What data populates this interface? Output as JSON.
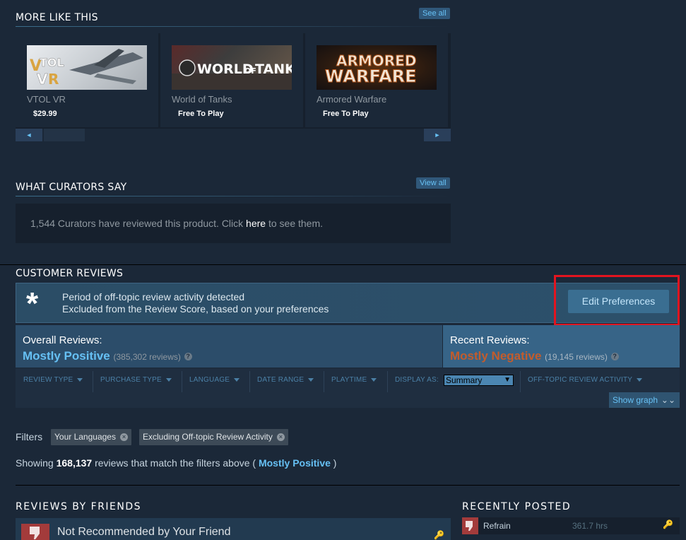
{
  "more_like_this": {
    "title": "MORE LIKE THIS",
    "see_all": "See all",
    "games": [
      {
        "name": "VTOL VR",
        "price": "$29.99",
        "capsule_text": "VTOL VR"
      },
      {
        "name": "World of Tanks",
        "price": "Free To Play",
        "capsule_text": "WORLD OF TANKS"
      },
      {
        "name": "Armored Warfare",
        "price": "Free To Play",
        "capsule_text": "ARMORED WARFARE"
      }
    ],
    "scroll_left": "◄",
    "scroll_right": "►"
  },
  "curators": {
    "title": "WHAT CURATORS SAY",
    "view_all": "View all",
    "text_before": "1,544 Curators have reviewed this product. Click ",
    "link": "here",
    "text_after": " to see them."
  },
  "customer_reviews": {
    "title": "CUSTOMER REVIEWS",
    "offtopic_line1": "Period of off-topic review activity detected",
    "offtopic_line2": "Excluded from the Review Score, based on your preferences",
    "edit_preferences": "Edit Preferences",
    "overall_label": "Overall Reviews:",
    "overall_score": "Mostly Positive",
    "overall_count": "(385,302 reviews)",
    "recent_label": "Recent Reviews:",
    "recent_score": "Mostly Negative",
    "recent_count": "(19,145 reviews)",
    "help": "?"
  },
  "filter_bar": {
    "items": [
      "REVIEW TYPE",
      "PURCHASE TYPE",
      "LANGUAGE",
      "DATE RANGE",
      "PLAYTIME"
    ],
    "display_as_label": "DISPLAY AS:",
    "display_as_value": "Summary",
    "offtopic_item": "OFF-TOPIC REVIEW ACTIVITY",
    "show_graph": "Show graph"
  },
  "filters": {
    "label": "Filters",
    "chips": [
      "Your Languages",
      "Excluding Off-topic Review Activity"
    ],
    "showing_before": "Showing ",
    "showing_count": "168,137",
    "showing_mid": " reviews that match the filters above ( ",
    "showing_score": "Mostly Positive",
    "showing_after": " )"
  },
  "friends": {
    "title": "REVIEWS BY FRIENDS",
    "item_text": "Not Recommended by Your Friend"
  },
  "recently_posted": {
    "title": "RECENTLY POSTED",
    "item_name": "Refrain",
    "item_hours": "361.7 hrs"
  },
  "colors": {
    "background": "#1b2838",
    "accent_blue": "#66c0f4",
    "negative_orange": "#c35c2c",
    "highlight_red": "#e3141f"
  }
}
